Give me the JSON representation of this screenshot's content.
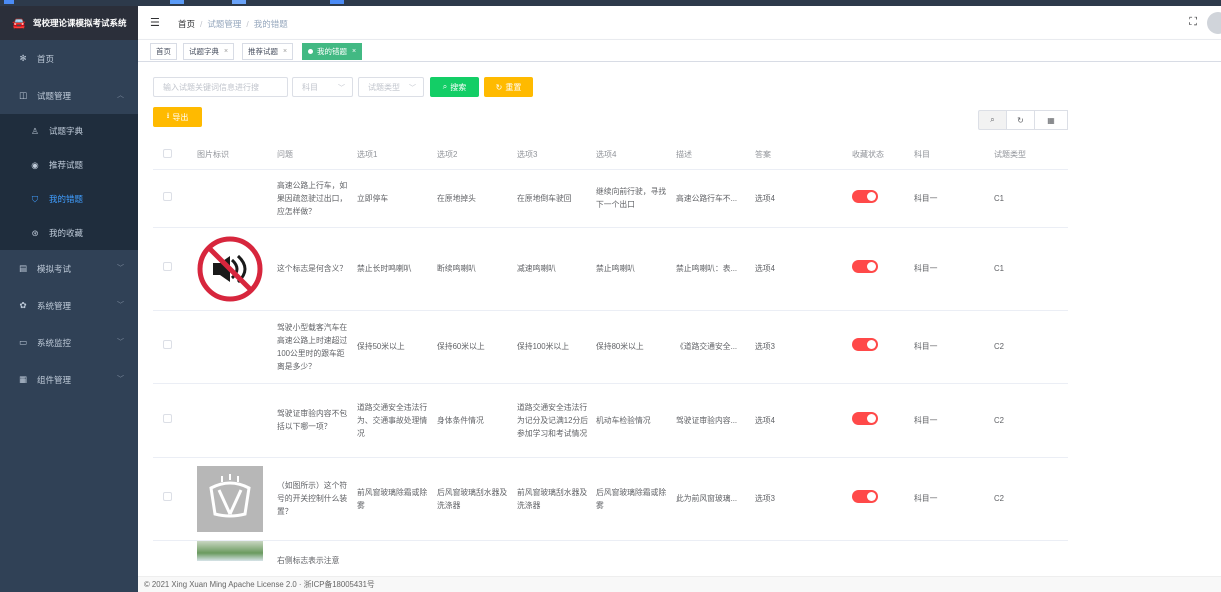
{
  "app": {
    "title": "驾校理论课模拟考试系统"
  },
  "sidebar": {
    "items": [
      {
        "label": "首页",
        "icon": "dashboard-icon"
      },
      {
        "label": "试题管理",
        "icon": "book-icon",
        "expanded": true,
        "children": [
          {
            "label": "试题字典",
            "icon": "user-icon"
          },
          {
            "label": "推荐试题",
            "icon": "eye-icon"
          },
          {
            "label": "我的错题",
            "icon": "shield-icon",
            "active": true
          },
          {
            "label": "我的收藏",
            "icon": "star-icon"
          }
        ]
      },
      {
        "label": "模拟考试",
        "icon": "list-icon"
      },
      {
        "label": "系统管理",
        "icon": "gear-icon"
      },
      {
        "label": "系统监控",
        "icon": "monitor-icon"
      },
      {
        "label": "组件管理",
        "icon": "grid-icon"
      }
    ]
  },
  "navbar": {
    "breadcrumb": [
      "首页",
      "试题管理",
      "我的错题"
    ]
  },
  "tags": [
    {
      "label": "首页"
    },
    {
      "label": "试题字典"
    },
    {
      "label": "推荐试题"
    },
    {
      "label": "我的错题",
      "active": true
    }
  ],
  "search": {
    "keyword_placeholder": "输入试题关键词信息进行搜",
    "subject_placeholder": "科目",
    "type_placeholder": "试题类型",
    "search_label": "搜索",
    "reset_label": "重置",
    "export_label": "导出"
  },
  "table": {
    "headers": [
      "图片标识",
      "问题",
      "选项1",
      "选项2",
      "选项3",
      "选项4",
      "描述",
      "答案",
      "收藏状态",
      "科目",
      "试题类型"
    ],
    "rows": [
      {
        "image": "",
        "question": "高速公路上行车，如果因疏忽驶过出口，应怎样做？",
        "opt1": "立即停车",
        "opt2": "在原地掉头",
        "opt3": "在原地倒车驶回",
        "opt4": "继续向前行驶，寻找下一个出口",
        "desc": "高速公路行车不...",
        "answer": "选项4",
        "fav": false,
        "subject": "科目一",
        "type": "C1"
      },
      {
        "image": "no-horn-sign",
        "question": "这个标志是何含义？",
        "opt1": "禁止长时鸣喇叭",
        "opt2": "断续鸣喇叭",
        "opt3": "减速鸣喇叭",
        "opt4": "禁止鸣喇叭",
        "desc": "禁止鸣喇叭：表...",
        "answer": "选项4",
        "fav": false,
        "subject": "科目一",
        "type": "C1"
      },
      {
        "image": "",
        "question": "驾驶小型载客汽车在高速公路上时速超过100公里时的跟车距离是多少？",
        "opt1": "保持50米以上",
        "opt2": "保持60米以上",
        "opt3": "保持100米以上",
        "opt4": "保持80米以上",
        "desc": "《道路交通安全...",
        "answer": "选项3",
        "fav": false,
        "subject": "科目一",
        "type": "C2"
      },
      {
        "image": "",
        "question": "驾驶证审验内容不包括以下哪一项？",
        "opt1": "道路交通安全违法行为、交通事故处理情况",
        "opt2": "身体条件情况",
        "opt3": "道路交通安全违法行为记分及记满12分后参加学习和考试情况",
        "opt4": "机动车检验情况",
        "desc": "驾驶证审验内容...",
        "answer": "选项4",
        "fav": false,
        "subject": "科目一",
        "type": "C2"
      },
      {
        "image": "wiper-symbol",
        "question": "（如图所示）这个符号的开关控制什么装置？",
        "opt1": "前风窗玻璃除霜或除雾",
        "opt2": "后风窗玻璃刮水器及洗涤器",
        "opt3": "前风窗玻璃刮水器及洗涤器",
        "opt4": "后风窗玻璃除霜或除雾",
        "desc": "此为前风窗玻璃...",
        "answer": "选项3",
        "fav": false,
        "subject": "科目一",
        "type": "C2"
      },
      {
        "image": "road-photo",
        "question": "右侧标志表示注意",
        "opt1": "",
        "opt2": "",
        "opt3": "",
        "opt4": "",
        "desc": "",
        "answer": "",
        "fav": null,
        "subject": "",
        "type": ""
      }
    ]
  },
  "footer": {
    "text": "© 2021 Xing Xuan Ming Apache License 2.0 · 浙ICP备18005431号"
  },
  "colors": {
    "sidebar_bg": "#304156",
    "active_tag": "#42b983",
    "primary": "#409eff",
    "success": "#13ce66",
    "warning": "#ffba00",
    "switch_off": "#ff4949"
  }
}
